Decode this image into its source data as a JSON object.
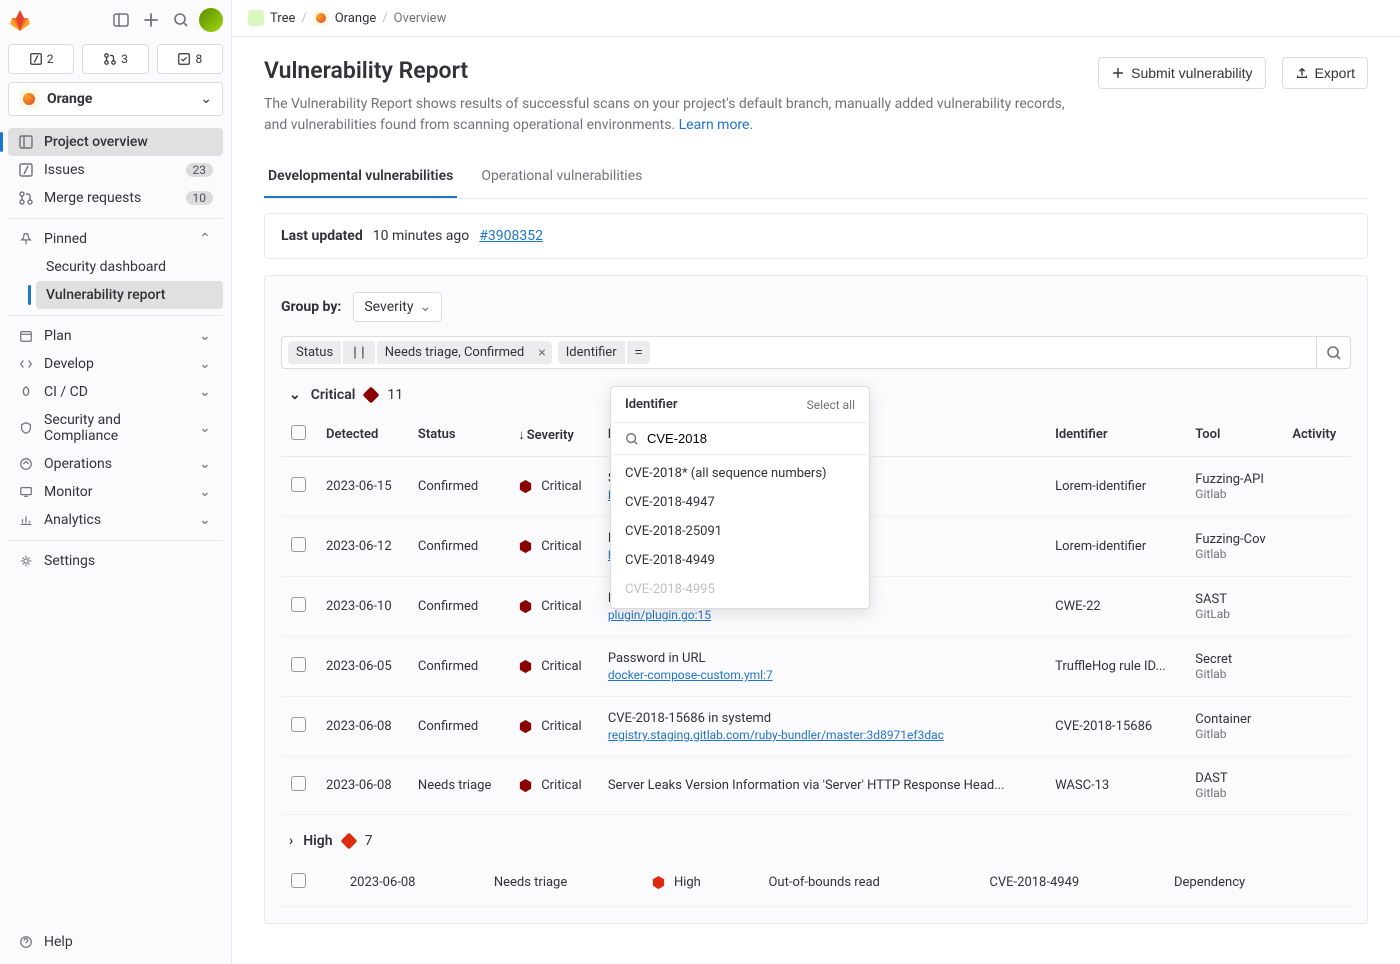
{
  "top_counts": {
    "issues": "2",
    "mrs": "3",
    "todos": "8"
  },
  "project": {
    "name": "Orange"
  },
  "nav": {
    "overview": "Project overview",
    "issues": "Issues",
    "issues_count": "23",
    "merge_requests": "Merge requests",
    "mr_count": "10",
    "pinned": "Pinned",
    "sec_dashboard": "Security dashboard",
    "vuln_report": "Vulnerability report",
    "plan": "Plan",
    "develop": "Develop",
    "cicd": "CI / CD",
    "sec_compliance": "Security and Compliance",
    "operations": "Operations",
    "monitor": "Monitor",
    "analytics": "Analytics",
    "settings": "Settings",
    "help": "Help"
  },
  "breadcrumb": {
    "group": "Tree",
    "project": "Orange",
    "page": "Overview"
  },
  "page": {
    "title": "Vulnerability Report",
    "description": "The Vulnerability Report shows results of successful scans on your project's default branch, manually added vulnerability records, and vulnerabilities found from scanning operational environments. ",
    "learn_more": "Learn more.",
    "submit_btn": "Submit vulnerability",
    "export_btn": "Export"
  },
  "tabs": {
    "dev": "Developmental vulnerabilities",
    "ops": "Operational vulnerabilities"
  },
  "info_bar": {
    "label": "Last updated",
    "time": "10 minutes ago",
    "pipeline": "#3908352"
  },
  "filters": {
    "group_by_label": "Group by:",
    "group_by_value": "Severity",
    "token_status_key": "Status",
    "token_status_op": "||",
    "token_status_val": "Needs triage, Confirmed",
    "token_ident_key": "Identifier",
    "token_ident_op": "="
  },
  "dropdown": {
    "title": "Identifier",
    "select_all": "Select all",
    "search_value": "CVE-2018",
    "items": [
      "CVE-2018* (all sequence numbers)",
      "CVE-2018-4947",
      "CVE-2018-25091",
      "CVE-2018-4949",
      "CVE-2018-4995"
    ]
  },
  "columns": {
    "detected": "Detected",
    "status": "Status",
    "severity": "Severity",
    "description": "Description",
    "identifier": "Identifier",
    "tool": "Tool",
    "activity": "Activity"
  },
  "groups": {
    "critical": {
      "label": "Critical",
      "count": "11"
    },
    "high": {
      "label": "High",
      "count": "7"
    }
  },
  "rows": {
    "critical": [
      {
        "detected": "2023-06-15",
        "status": "Confirmed",
        "severity": "Critical",
        "title": "SQL I",
        "path": "Host:",
        "identifier": "Lorem-identifier",
        "tool": "Fuzzing-API",
        "tool_sub": "Gitlab"
      },
      {
        "detected": "2023-06-12",
        "status": "Confirmed",
        "severity": "Critical",
        "title": "Heap",
        "path": "EndP",
        "identifier": "Lorem-identifier",
        "tool": "Fuzzing-Cov",
        "tool_sub": "Gitlab"
      },
      {
        "detected": "2023-06-10",
        "status": "Confirmed",
        "severity": "Critical",
        "title": "Potential file inclusion via variable",
        "path": "plugin/plugin.go:15",
        "identifier": "CWE-22",
        "tool": "SAST",
        "tool_sub": "GitLab"
      },
      {
        "detected": "2023-06-05",
        "status": "Confirmed",
        "severity": "Critical",
        "title": "Password in URL",
        "path": "docker-compose-custom.yml:7",
        "identifier": "TruffleHog rule ID...",
        "tool": "Secret",
        "tool_sub": "Gitlab"
      },
      {
        "detected": "2023-06-08",
        "status": "Confirmed",
        "severity": "Critical",
        "title": "CVE-2018-15686 in systemd",
        "path": "registry.staging.gitlab.com/ruby-bundler/master:3d8971ef3dac",
        "identifier": "CVE-2018-15686",
        "tool": "Container",
        "tool_sub": "Gitlab"
      },
      {
        "detected": "2023-06-08",
        "status": "Needs triage",
        "severity": "Critical",
        "title": "Server Leaks Version Information via 'Server' HTTP Response Head...",
        "path": "",
        "identifier": "WASC-13",
        "tool": "DAST",
        "tool_sub": "Gitlab"
      }
    ],
    "high": [
      {
        "detected": "2023-06-08",
        "status": "Needs triage",
        "severity": "High",
        "title": "Out-of-bounds read",
        "path": "",
        "identifier": "CVE-2018-4949",
        "tool": "Dependency",
        "tool_sub": ""
      }
    ]
  }
}
